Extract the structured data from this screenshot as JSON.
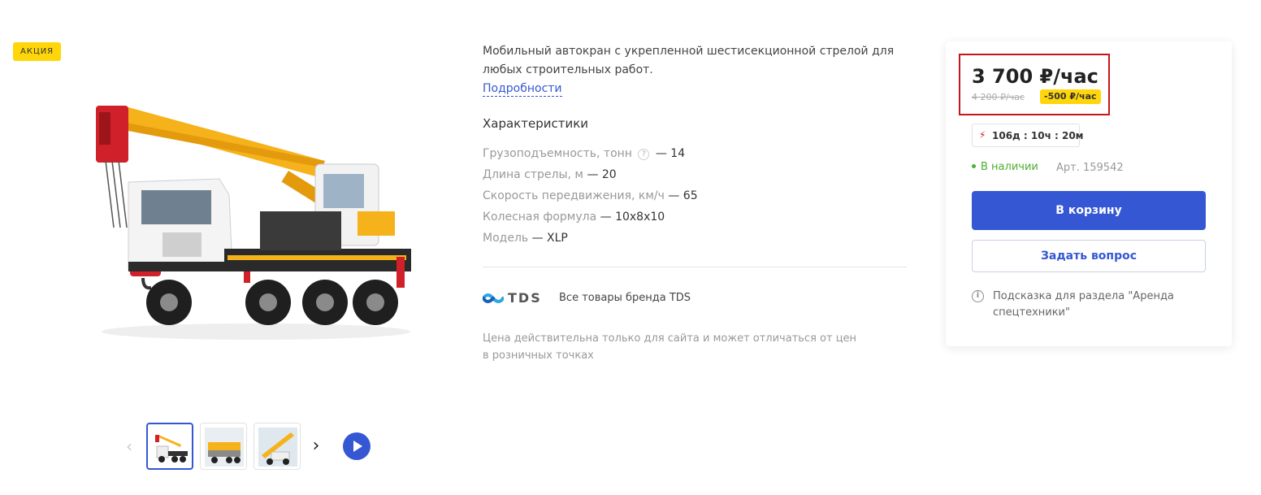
{
  "badge": {
    "label": "АКЦИЯ"
  },
  "gallery": {
    "main_image": "truck-crane-photo",
    "prev_icon": "chevron-left-icon",
    "next_icon": "chevron-right-icon",
    "video_icon": "play-icon",
    "thumbnails": [
      "truck-crane-photo",
      "truck-crane-side-photo",
      "truck-crane-boom-photo"
    ]
  },
  "description": {
    "text": "Мобильный автокран с укрепленной шестисекционной стрелой для любых строительных работ.",
    "details_link": "Подробности",
    "specs_title": "Характеристики",
    "specs": [
      {
        "label": "Грузоподъемность, тонн",
        "help": "?",
        "value": "— 14"
      },
      {
        "label": "Длина стрелы, м",
        "value": "— 20"
      },
      {
        "label": "Скорость передвижения, км/ч",
        "value": "— 65"
      },
      {
        "label": "Колесная формула",
        "value": "— 10x8x10"
      },
      {
        "label": "Модель",
        "value": "— XLP"
      }
    ],
    "brand": {
      "name": "TDS",
      "link": "Все товары бренда TDS"
    },
    "price_note": "Цена действительна только для сайта и может отличаться от цен в розничных точках"
  },
  "buy_box": {
    "price": "3 700 ₽/час",
    "old_price": "4 200 ₽/час",
    "discount": "-500 ₽/час",
    "timer": "106д : 10ч : 20м",
    "stock": "В наличии",
    "sku": "Арт. 159542",
    "cart_button": "В корзину",
    "ask_button": "Задать вопрос",
    "hint": "Подсказка для раздела \"Аренда спецтехники\""
  },
  "colors": {
    "accent": "#3557d4",
    "promo": "#ffd60a",
    "highlight_border": "#c8151c",
    "in_stock": "#4caf2f",
    "crane_yellow": "#f5b21a",
    "crane_red": "#d0202a"
  }
}
